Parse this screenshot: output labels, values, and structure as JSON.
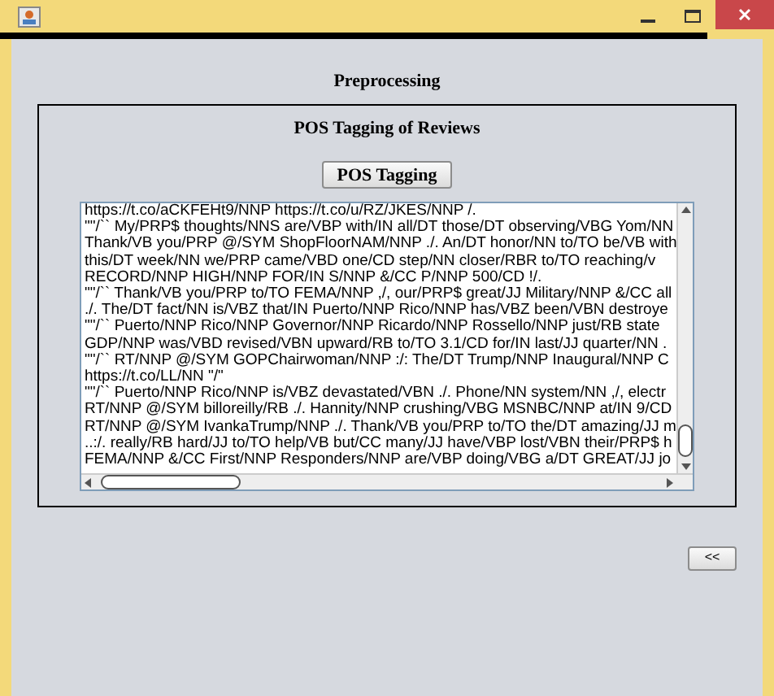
{
  "heading": "Preprocessing",
  "panel": {
    "title": "POS Tagging of Reviews",
    "button": "POS Tagging",
    "output_lines": [
      "https://t.co/aCKFEHt9/NNP https://t.co/u/RZ/JKES/NNP /.",
      "\"\"/`` My/PRP$ thoughts/NNS are/VBP with/IN all/DT those/DT observing/VBG Yom/NN",
      "Thank/VB you/PRP @/SYM ShopFloorNAM/NNP ./. An/DT honor/NN to/TO be/VB with",
      "this/DT week/NN we/PRP came/VBD one/CD step/NN closer/RBR to/TO reaching/v",
      "RECORD/NNP HIGH/NNP FOR/IN S/NNP &/CC P/NNP 500/CD !/.",
      "\"\"/`` Thank/VB you/PRP to/TO FEMA/NNP ,/, our/PRP$ great/JJ Military/NNP &/CC all",
      "./. The/DT fact/NN is/VBZ that/IN Puerto/NNP Rico/NNP has/VBZ been/VBN destroye",
      "\"\"/`` Puerto/NNP Rico/NNP Governor/NNP Ricardo/NNP Rossello/NNP just/RB state",
      "GDP/NNP was/VBD revised/VBN upward/RB to/TO 3.1/CD for/IN last/JJ quarter/NN .",
      "\"\"/`` RT/NNP @/SYM GOPChairwoman/NNP :/: The/DT Trump/NNP Inaugural/NNP C",
      "https://t.co/LL/NN \"/\"",
      "\"\"/`` Puerto/NNP Rico/NNP is/VBZ devastated/VBN ./. Phone/NN system/NN ,/, electr",
      "RT/NNP @/SYM billoreilly/RB ./. Hannity/NNP crushing/VBG MSNBC/NNP at/IN 9/CD",
      "RT/NNP @/SYM IvankaTrump/NNP ./. Thank/VB you/PRP to/TO the/DT amazing/JJ m",
      "..:/. really/RB hard/JJ to/TO help/VB but/CC many/JJ have/VBP lost/VBN their/PRP$ h",
      "FEMA/NNP &/CC First/NNP Responders/NNP are/VBP doing/VBG a/DT GREAT/JJ jo"
    ]
  },
  "back_button": "<<"
}
